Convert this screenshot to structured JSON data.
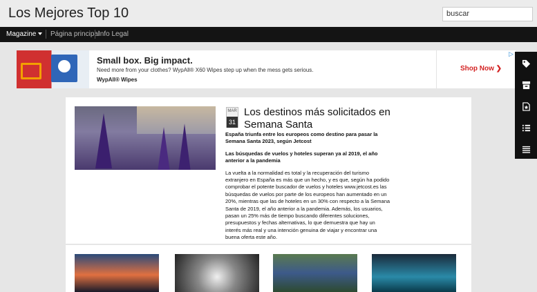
{
  "header": {
    "site_title": "Los Mejores Top 10",
    "search_value": "buscar"
  },
  "nav": {
    "items": [
      "Magazine",
      "Página principal",
      "Info Legal"
    ]
  },
  "ad": {
    "headline": "Small box. Big impact.",
    "subtext": "Need more from your clothes? WypAll® X60 Wipes step up when the mess gets serious.",
    "brand": "WypAll® Wipes",
    "cta": "Shop Now",
    "choices_icon": "▷"
  },
  "sidebar": {
    "icons": [
      "tag-icon",
      "archive-icon",
      "star-page-icon",
      "list-icon",
      "menu-icon"
    ]
  },
  "post": {
    "date_month": "MAR",
    "date_day": "31",
    "title": "Los destinos más solicitados en Semana Santa",
    "paragraphs": [
      "España triunfa entre los europeos como destino para pasar la Semana Santa 2023, según Jetcost",
      "Las búsquedas de vuelos y hoteles superan ya al 2019, el año anterior a la pandemia",
      "La vuelta a la normalidad es total y la recuperación del turismo extranjero en España es más que un hecho, y es que, según ha podido comprobar el potente buscador de vuelos y hoteles www.jetcost.es las búsquedas de vuelos por parte de los europeos han aumentado en un 20%, mientras que las de hoteles en un 30% con respecto a la Semana Santa de 2019, el año anterior a la pandemia. Además, los usuarios, pasan un 25% más de tiempo buscando diferentes soluciones, presupuestos y fechas alternativas, lo que demuestra que hay un interés más real y una intención genuina de viajar y encontrar una buena oferta este año."
    ]
  }
}
